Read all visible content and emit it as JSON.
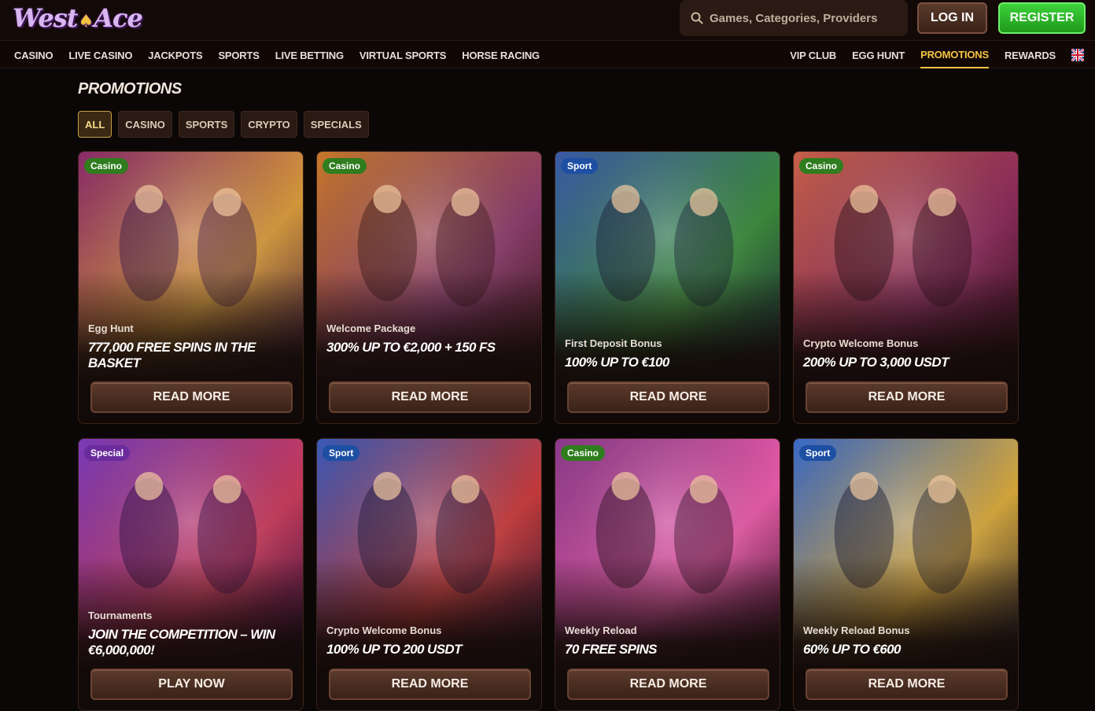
{
  "header": {
    "logo_text": "West",
    "logo_text2": "Ace",
    "search_placeholder": "Games, Categories, Providers",
    "login_label": "LOG IN",
    "register_label": "REGISTER"
  },
  "nav": {
    "left": [
      "CASINO",
      "LIVE CASINO",
      "JACKPOTS",
      "SPORTS",
      "LIVE BETTING",
      "VIRTUAL SPORTS",
      "HORSE RACING"
    ],
    "right": [
      "VIP CLUB",
      "EGG HUNT",
      "PROMOTIONS",
      "REWARDS"
    ],
    "active": "PROMOTIONS",
    "flag_icon": "uk-flag-icon"
  },
  "page": {
    "title": "PROMOTIONS",
    "filters": [
      "ALL",
      "CASINO",
      "SPORTS",
      "CRYPTO",
      "SPECIALS"
    ],
    "active_filter": "ALL"
  },
  "promotions": [
    {
      "badge": "Casino",
      "badge_type": "casino",
      "subtitle": "Egg Hunt",
      "headline": "777,000 FREE SPINS IN THE BASKET",
      "cta": "READ MORE",
      "palette": [
        "#8a2a6a",
        "#d89a3a",
        "#3a1848"
      ]
    },
    {
      "badge": "Casino",
      "badge_type": "casino",
      "subtitle": "Welcome Package",
      "headline": "300% UP TO €2,000 + 150 FS",
      "cta": "READ MORE",
      "palette": [
        "#c8782a",
        "#8a3a6a",
        "#3a1a18"
      ]
    },
    {
      "badge": "Sport",
      "badge_type": "sport",
      "subtitle": "First Deposit Bonus",
      "headline": "100% UP TO €100",
      "cta": "READ MORE",
      "palette": [
        "#3a5aa8",
        "#3a8a3a",
        "#1a2038"
      ]
    },
    {
      "badge": "Casino",
      "badge_type": "casino",
      "subtitle": "Crypto Welcome Bonus",
      "headline": "200% UP TO 3,000 USDT",
      "cta": "READ MORE",
      "palette": [
        "#c8604a",
        "#8a2a5a",
        "#2a1018"
      ]
    },
    {
      "badge": "Special",
      "badge_type": "special",
      "subtitle": "Tournaments",
      "headline": "JOIN THE COMPETITION – WIN €6,000,000!",
      "cta": "PLAY NOW",
      "palette": [
        "#7a3ab8",
        "#c83a5a",
        "#2a1040"
      ]
    },
    {
      "badge": "Sport",
      "badge_type": "sport",
      "subtitle": "Crypto Welcome Bonus",
      "headline": "100% UP TO 200 USDT",
      "cta": "READ MORE",
      "palette": [
        "#3a5ab8",
        "#c83a3a",
        "#1a1838"
      ]
    },
    {
      "badge": "Casino",
      "badge_type": "casino",
      "subtitle": "Weekly Reload",
      "headline": "70 FREE SPINS",
      "cta": "READ MORE",
      "palette": [
        "#8a3a8a",
        "#e85aa8",
        "#2a1020"
      ]
    },
    {
      "badge": "Sport",
      "badge_type": "sport",
      "subtitle": "Weekly Reload Bonus",
      "headline": "60% UP TO €600",
      "cta": "READ MORE",
      "palette": [
        "#3a6ac8",
        "#d8a83a",
        "#1a1a30"
      ]
    }
  ]
}
